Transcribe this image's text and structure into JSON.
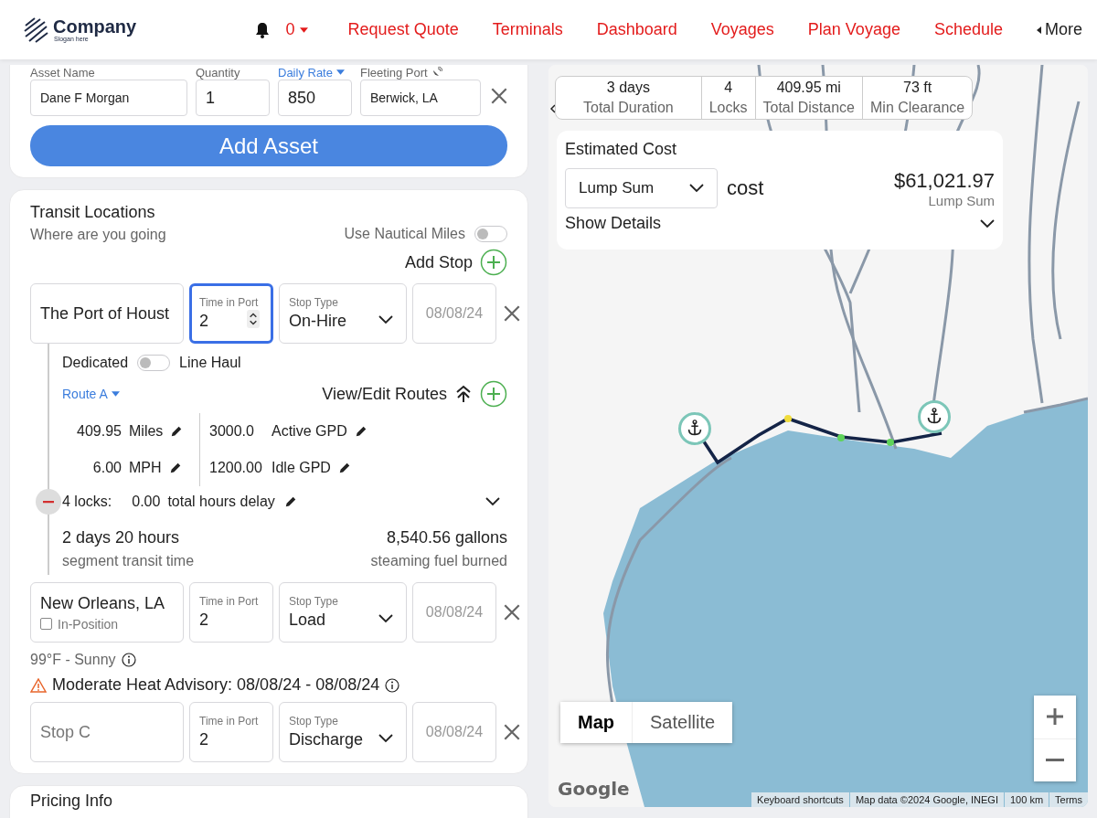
{
  "header": {
    "logo": {
      "name": "Company",
      "slogan": "Slogan here"
    },
    "notifications": "0",
    "nav": [
      {
        "label": "Request Quote"
      },
      {
        "label": "Terminals"
      },
      {
        "label": "Dashboard"
      },
      {
        "label": "Voyages"
      },
      {
        "label": "Plan Voyage"
      },
      {
        "label": "Schedule"
      }
    ],
    "more": "More"
  },
  "asset": {
    "fields": [
      {
        "kind": "text",
        "label": "Asset Name",
        "value": "Dane F Morgan"
      },
      {
        "kind": "number",
        "label": "Quantity",
        "value": "1"
      },
      {
        "kind": "menu",
        "label": "Daily Rate",
        "value": "850"
      },
      {
        "kind": "icon",
        "label": "Fleeting Port",
        "value": "Berwick, LA"
      }
    ],
    "add_button": "Add Asset"
  },
  "transit": {
    "title": "Transit Locations",
    "subtitle": "Where are you going",
    "nautical": {
      "label": "Use Nautical Miles",
      "on": false
    },
    "add_stop": "Add Stop",
    "stops": [
      {
        "location": {
          "value": "The Port of Houst"
        },
        "time": {
          "label": "Time in Port",
          "value": "2",
          "focused": true
        },
        "stop_type": {
          "label": "Stop Type",
          "value": "On-Hire"
        },
        "date": {
          "placeholder": "08/08/24"
        },
        "segment": {
          "mode": {
            "left": "Dedicated",
            "right": "Line Haul",
            "on": false
          },
          "route": "Route A",
          "view_edit": "View/Edit Routes",
          "stats": [
            {
              "value": "409.95",
              "unit": "Miles"
            },
            {
              "value": "6.00",
              "unit": "MPH"
            },
            {
              "value": "3000.0",
              "unit": "Active GPD"
            },
            {
              "value": "1200.00",
              "unit": "Idle GPD"
            }
          ],
          "locks": {
            "count": "4 locks:",
            "delay": "0.00",
            "delay_label": "total hours delay",
            "expanded": false
          },
          "transit_time": {
            "value": "2 days 20 hours",
            "label": "segment transit time"
          },
          "fuel": {
            "value": "8,540.56 gallons",
            "label": "steaming fuel burned"
          }
        }
      },
      {
        "location": {
          "value": "New Orleans, LA"
        },
        "in_position": {
          "label": "In-Position",
          "checked": false
        },
        "time": {
          "label": "Time in Port",
          "value": "2",
          "focused": false
        },
        "stop_type": {
          "label": "Stop Type",
          "value": "Load"
        },
        "date": {
          "placeholder": "08/08/24"
        },
        "weather": "99°F - Sunny",
        "advisory": "Moderate Heat Advisory: 08/08/24 - 08/08/24"
      },
      {
        "location": {
          "placeholder": "Stop C"
        },
        "time": {
          "label": "Time in Port",
          "value": "2",
          "focused": false
        },
        "stop_type": {
          "label": "Stop Type",
          "value": "Discharge"
        },
        "date": {
          "placeholder": "08/08/24"
        }
      }
    ]
  },
  "pricing": {
    "title": "Pricing Info"
  },
  "map": {
    "summary": [
      {
        "value": "3 days",
        "label": "Total Duration"
      },
      {
        "value": "4",
        "label": "Locks"
      },
      {
        "value": "409.95 mi",
        "label": "Total Distance"
      },
      {
        "value": "73 ft",
        "label": "Min Clearance"
      }
    ],
    "cost": {
      "title": "Estimated Cost",
      "basis": "Lump Sum",
      "word": "cost",
      "amount": "$61,021.97",
      "amount_note": "Lump Sum",
      "details": "Show Details",
      "expanded": false
    },
    "locks": [
      {
        "color": "#f0dc3c"
      },
      {
        "color": "#5fd35a"
      },
      {
        "color": "#5fd35a"
      }
    ],
    "map_types": [
      {
        "label": "Map",
        "selected": true
      },
      {
        "label": "Satellite",
        "selected": false
      }
    ],
    "logo": "Google",
    "attribution": [
      "Keyboard shortcuts",
      "Map data ©2024 Google, INEGI",
      "100 km",
      "Terms"
    ]
  }
}
